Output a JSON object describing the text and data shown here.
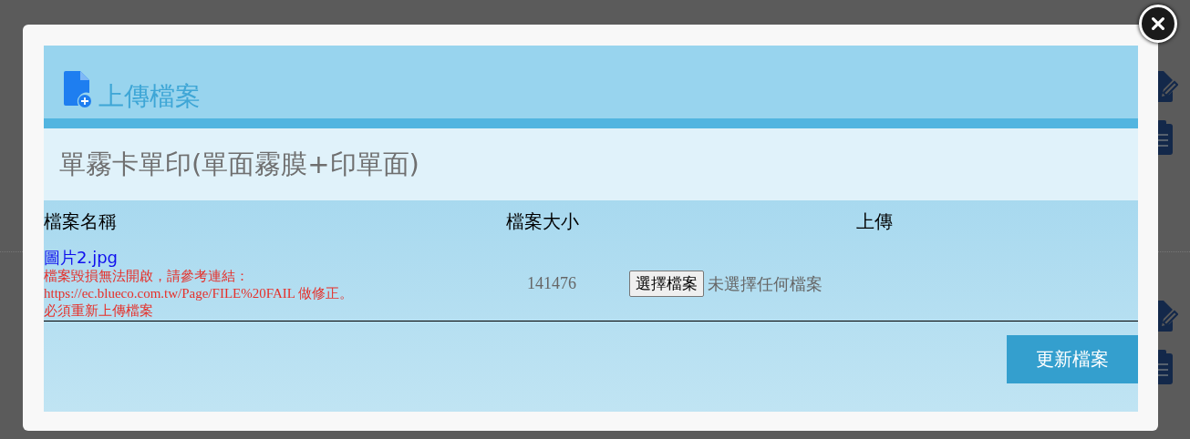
{
  "modal": {
    "title": "上傳檔案",
    "subtitle": "單霧卡單印(單面霧膜+印單面)",
    "columns": [
      "檔案名稱",
      "檔案大小",
      "上傳"
    ],
    "rows": [
      {
        "file_name": "圖片2.jpg",
        "error_lines": [
          "檔案毀損無法開啟，請參考連結：",
          "https://ec.blueco.com.tw/Page/FILE%20FAIL 做修正。",
          "必須重新上傳檔案"
        ],
        "size": "141476",
        "choose_button": "選擇檔案",
        "no_file": "未選擇任何檔案"
      }
    ],
    "submit": "更新檔案"
  }
}
